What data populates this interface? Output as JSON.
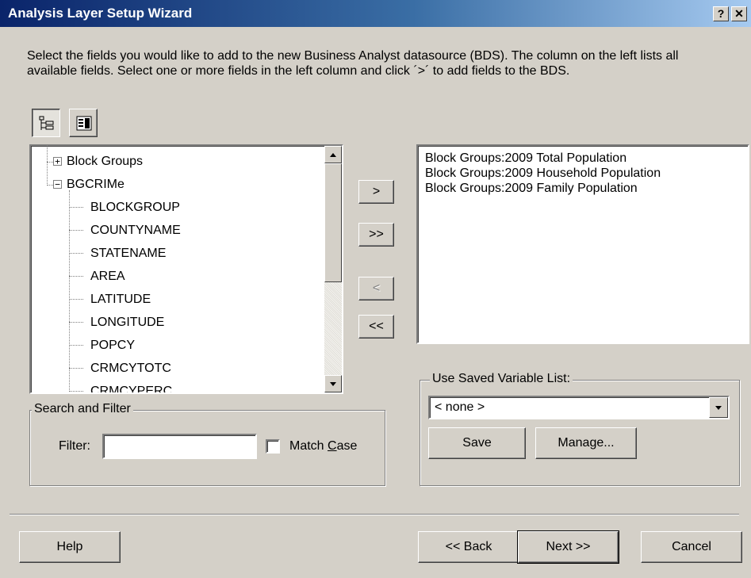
{
  "window": {
    "title": "Analysis Layer Setup Wizard",
    "help_glyph": "?",
    "close_glyph": "✕"
  },
  "instructions": "Select the fields you would like to add to the new Business Analyst datasource (BDS).  The column on the left lists all available fields.  Select one or more fields in the left column and click ´>´ to add fields to the BDS.",
  "toolbar": {
    "buttons": [
      {
        "name": "tree-view-icon",
        "pressed": true
      },
      {
        "name": "list-view-icon",
        "pressed": false
      }
    ]
  },
  "field_tree": {
    "nodes": [
      {
        "label": "Block Groups",
        "expander": "+"
      },
      {
        "label": "BGCRIMe",
        "expander": "−"
      }
    ],
    "fields": [
      "BLOCKGROUP",
      "COUNTYNAME",
      "STATENAME",
      "AREA",
      "LATITUDE",
      "LONGITUDE",
      "POPCY",
      "CRMCYTOTC",
      "CRMCYPERC"
    ]
  },
  "transfer_buttons": {
    "add": ">",
    "add_all": ">>",
    "remove": "<",
    "remove_all": "<<"
  },
  "selected_fields": {
    "items": [
      "Block Groups:2009 Total Population",
      "Block Groups:2009 Household Population",
      "Block Groups:2009 Family Population"
    ]
  },
  "search_filter": {
    "group_label": "Search and Filter",
    "filter_label": "Filter:",
    "filter_value": "",
    "match_case_prefix": "Match ",
    "match_case_underlined": "C",
    "match_case_suffix": "ase",
    "match_case_checked": false
  },
  "saved_variables": {
    "group_label": "Use Saved Variable List:",
    "selected": "< none >",
    "save_label": "Save",
    "manage_label": "Manage..."
  },
  "footer": {
    "help_label": "Help",
    "back_label": "<< Back",
    "next_label": "Next >>",
    "cancel_label": "Cancel"
  }
}
